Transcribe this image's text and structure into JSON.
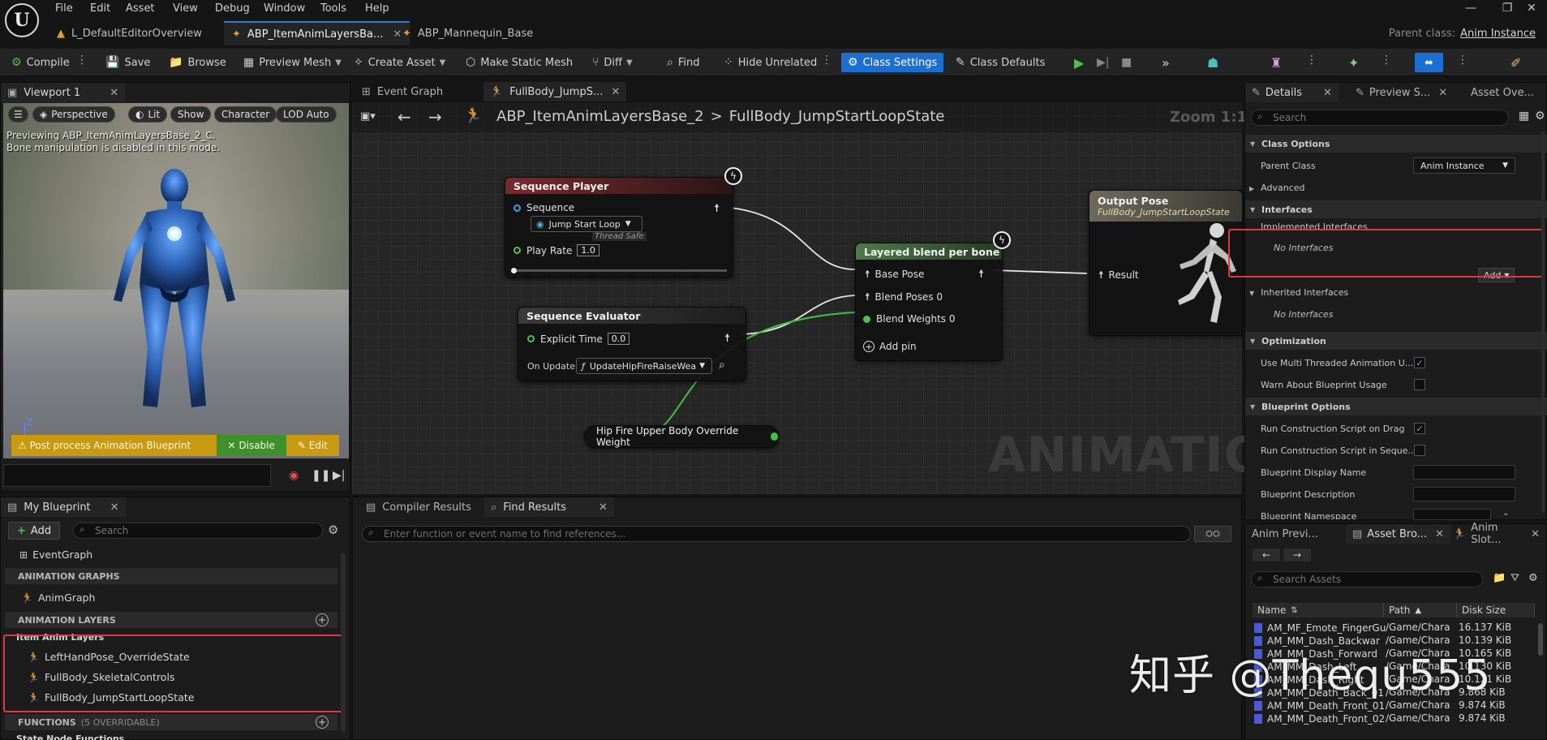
{
  "app": {
    "logo": "U",
    "menu": [
      "File",
      "Edit",
      "Asset",
      "View",
      "Debug",
      "Window",
      "Tools",
      "Help"
    ],
    "doc_tabs": [
      "L_DefaultEditorOverview",
      "ABP_ItemAnimLayersBa...",
      "ABP_Mannequin_Base"
    ],
    "parent_class_label": "Parent class:",
    "parent_class_value": "Anim Instance"
  },
  "toolbar": {
    "compile": "Compile",
    "save": "Save",
    "browse": "Browse",
    "preview_mesh": "Preview Mesh",
    "create_asset": "Create Asset",
    "make_static_mesh": "Make Static Mesh",
    "diff": "Diff",
    "find": "Find",
    "hide_unrelated": "Hide Unrelated",
    "class_settings": "Class Settings",
    "class_defaults": "Class Defaults"
  },
  "viewport": {
    "tab": "Viewport 1",
    "pills": [
      "Perspective",
      "Lit",
      "Show",
      "Character",
      "LOD Auto"
    ],
    "info_line1": "Previewing ABP_ItemAnimLayersBase_2_C.",
    "info_line2": "Bone manipulation is disabled in this mode.",
    "axis_label": "Z",
    "pp_text": "⚠ Post process Animation Blueprint",
    "pp_disable": "✕ Disable",
    "pp_edit": "✎ Edit"
  },
  "myblueprint": {
    "tab": "My Blueprint",
    "add": "Add",
    "search_placeholder": "Search",
    "event_graph": "EventGraph",
    "sec_anim_graphs": "ANIMATION GRAPHS",
    "anim_graph": "AnimGraph",
    "sec_anim_layers": "ANIMATION LAYERS",
    "item_anim_layers": "Item Anim Layers",
    "layers": [
      "LeftHandPose_OverrideState",
      "FullBody_SkeletalControls",
      "FullBody_JumpStartLoopState"
    ],
    "sec_functions": "FUNCTIONS",
    "functions_count": "(5 OVERRIDABLE)",
    "state_node_functions": "State Node Functions"
  },
  "graph": {
    "tabs": [
      "Event Graph",
      "FullBody_JumpS..."
    ],
    "breadcrumb_root": "ABP_ItemAnimLayersBase_2",
    "breadcrumb_sep": ">",
    "breadcrumb_leaf": "FullBody_JumpStartLoopState",
    "zoom": "Zoom 1:1",
    "watermark": "ANIMATION",
    "sequence_player": {
      "title": "Sequence Player",
      "sequence_label": "Sequence",
      "sequence_value": "Jump Start Loop",
      "thread_safe": "Thread Safe",
      "play_rate_label": "Play Rate",
      "play_rate_value": "1.0"
    },
    "sequence_evaluator": {
      "title": "Sequence Evaluator",
      "explicit_time_label": "Explicit Time",
      "explicit_time_value": "0.0",
      "on_update_label": "On Update",
      "on_update_value": "UpdateHipFireRaiseWea"
    },
    "layered_blend": {
      "title": "Layered blend per bone",
      "base_pose": "Base Pose",
      "blend_poses": "Blend Poses 0",
      "blend_weights": "Blend Weights 0",
      "add_pin": "Add pin"
    },
    "output_pose": {
      "title": "Output Pose",
      "subtitle": "FullBody_JumpStartLoopState",
      "result": "Result"
    },
    "hip_fire": "Hip Fire Upper Body Override Weight"
  },
  "results": {
    "tabs": [
      "Compiler Results",
      "Find Results"
    ],
    "search_placeholder": "Enter function or event name to find references..."
  },
  "details": {
    "tabs": [
      "Details",
      "Preview S...",
      "Asset Ove..."
    ],
    "search_placeholder": "Search",
    "sec_class_options": "Class Options",
    "parent_class": "Parent Class",
    "parent_class_value": "Anim Instance",
    "advanced": "Advanced",
    "sec_interfaces": "Interfaces",
    "implemented_interfaces": "Implemented Interfaces",
    "no_interfaces": "No Interfaces",
    "add": "Add",
    "inherited_interfaces": "Inherited Interfaces",
    "no_interfaces_2": "No Interfaces",
    "sec_optimization": "Optimization",
    "use_multi_threaded": "Use Multi Threaded Animation U...",
    "warn_blueprint_usage": "Warn About Blueprint Usage",
    "sec_blueprint_options": "Blueprint Options",
    "run_on_drag": "Run Construction Script on Drag",
    "run_in_sequencer": "Run Construction Script in Seque...",
    "bp_display_name": "Blueprint Display Name",
    "bp_description": "Blueprint Description",
    "bp_namespace": "Blueprint Namespace"
  },
  "asset_browser": {
    "tabs": [
      "Anim Previ...",
      "Asset Bro...",
      "Anim Slot..."
    ],
    "search_placeholder": "Search Assets",
    "col_name": "Name",
    "col_path": "Path",
    "col_size": "Disk Size",
    "rows": [
      {
        "name": "AM_MF_Emote_FingerGu",
        "path": "/Game/Chara",
        "size": "16.137 KiB"
      },
      {
        "name": "AM_MM_Dash_Backwar",
        "path": "/Game/Chara",
        "size": "10.139 KiB"
      },
      {
        "name": "AM_MM_Dash_Forward",
        "path": "/Game/Chara",
        "size": "10.165 KiB"
      },
      {
        "name": "AM_MM_Dash_Left",
        "path": "/Game/Chara",
        "size": "10.130 KiB"
      },
      {
        "name": "AM_MM_Dash_Right",
        "path": "/Game/Chara",
        "size": "10.121 KiB"
      },
      {
        "name": "AM_MM_Death_Back_01",
        "path": "/Game/Chara",
        "size": "9.868 KiB"
      },
      {
        "name": "AM_MM_Death_Front_01",
        "path": "/Game/Chara",
        "size": "9.874 KiB"
      },
      {
        "name": "AM_MM_Death_Front_02",
        "path": "/Game/Chara",
        "size": "9.874 KiB"
      }
    ]
  },
  "watermark_text": "知乎 @Thequ555"
}
